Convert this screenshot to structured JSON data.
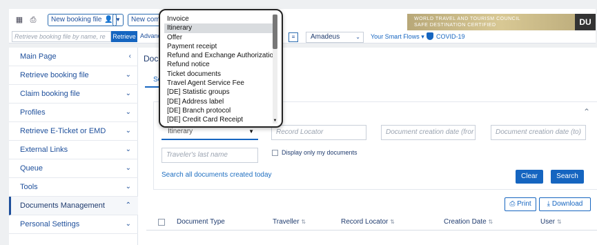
{
  "topbar": {
    "new_booking_label": "New booking file",
    "new_comm_label": "New comm",
    "retrieve_placeholder": "Retrieve booking file by name, re",
    "retrieve_label": "Retrieve",
    "advanced_label": "Advanc",
    "gds_box_label": "≡",
    "gds_selected": "Amadeus",
    "smart_flows_label": "Your Smart Flows ▾",
    "covid_label": "COVID-19",
    "banner_text": "WORLD TRAVEL AND TOURISM COUNCIL\nSAFE DESTINATION CERTIFIED",
    "banner_logo": "DU"
  },
  "sidebar": {
    "items": [
      {
        "label": "Main Page",
        "chevron": "‹"
      },
      {
        "label": "Retrieve booking file",
        "chevron": "⌄"
      },
      {
        "label": "Claim booking file",
        "chevron": "⌄"
      },
      {
        "label": "Profiles",
        "chevron": "⌄"
      },
      {
        "label": "Retrieve E-Ticket or EMD",
        "chevron": "⌄"
      },
      {
        "label": "External Links",
        "chevron": "⌄"
      },
      {
        "label": "Queue",
        "chevron": "⌄"
      },
      {
        "label": "Tools",
        "chevron": "⌄"
      },
      {
        "label": "Documents Management",
        "chevron": "⌃"
      },
      {
        "label": "Personal Settings",
        "chevron": "⌄"
      }
    ]
  },
  "main": {
    "title": "Docu",
    "tab_label": "Se",
    "document_type_selected": "Itinerary",
    "record_locator_placeholder": "Record Locator",
    "doc_date_from_placeholder": "Document creation date (fror",
    "doc_date_to_placeholder": "Document creation date (to)",
    "traveler_placeholder": "Traveler's last name",
    "display_only_mine": "Display only my documents",
    "search_today": "Search all documents created today",
    "clear_label": "Clear",
    "search_label": "Search",
    "print_label": "Print",
    "download_label": "Download",
    "columns": {
      "document_type": "Document Type",
      "traveller": "Traveller",
      "record_locator": "Record Locator",
      "creation_date": "Creation Date",
      "user": "User"
    }
  },
  "dropdown": {
    "options": [
      "Invoice",
      "Itinerary",
      "Offer",
      "Payment receipt",
      "Refund and Exchange Authorization",
      "Refund notice",
      "Ticket documents",
      "Travel Agent Service Fee",
      "[DE] Statistic groups",
      "[DE] Address label",
      "[DE] Branch protocol",
      "[DE] Credit Card Receipt"
    ],
    "selected_index": 1
  },
  "colors": {
    "accent": "#1565c0",
    "text": "#1f3b6e"
  }
}
